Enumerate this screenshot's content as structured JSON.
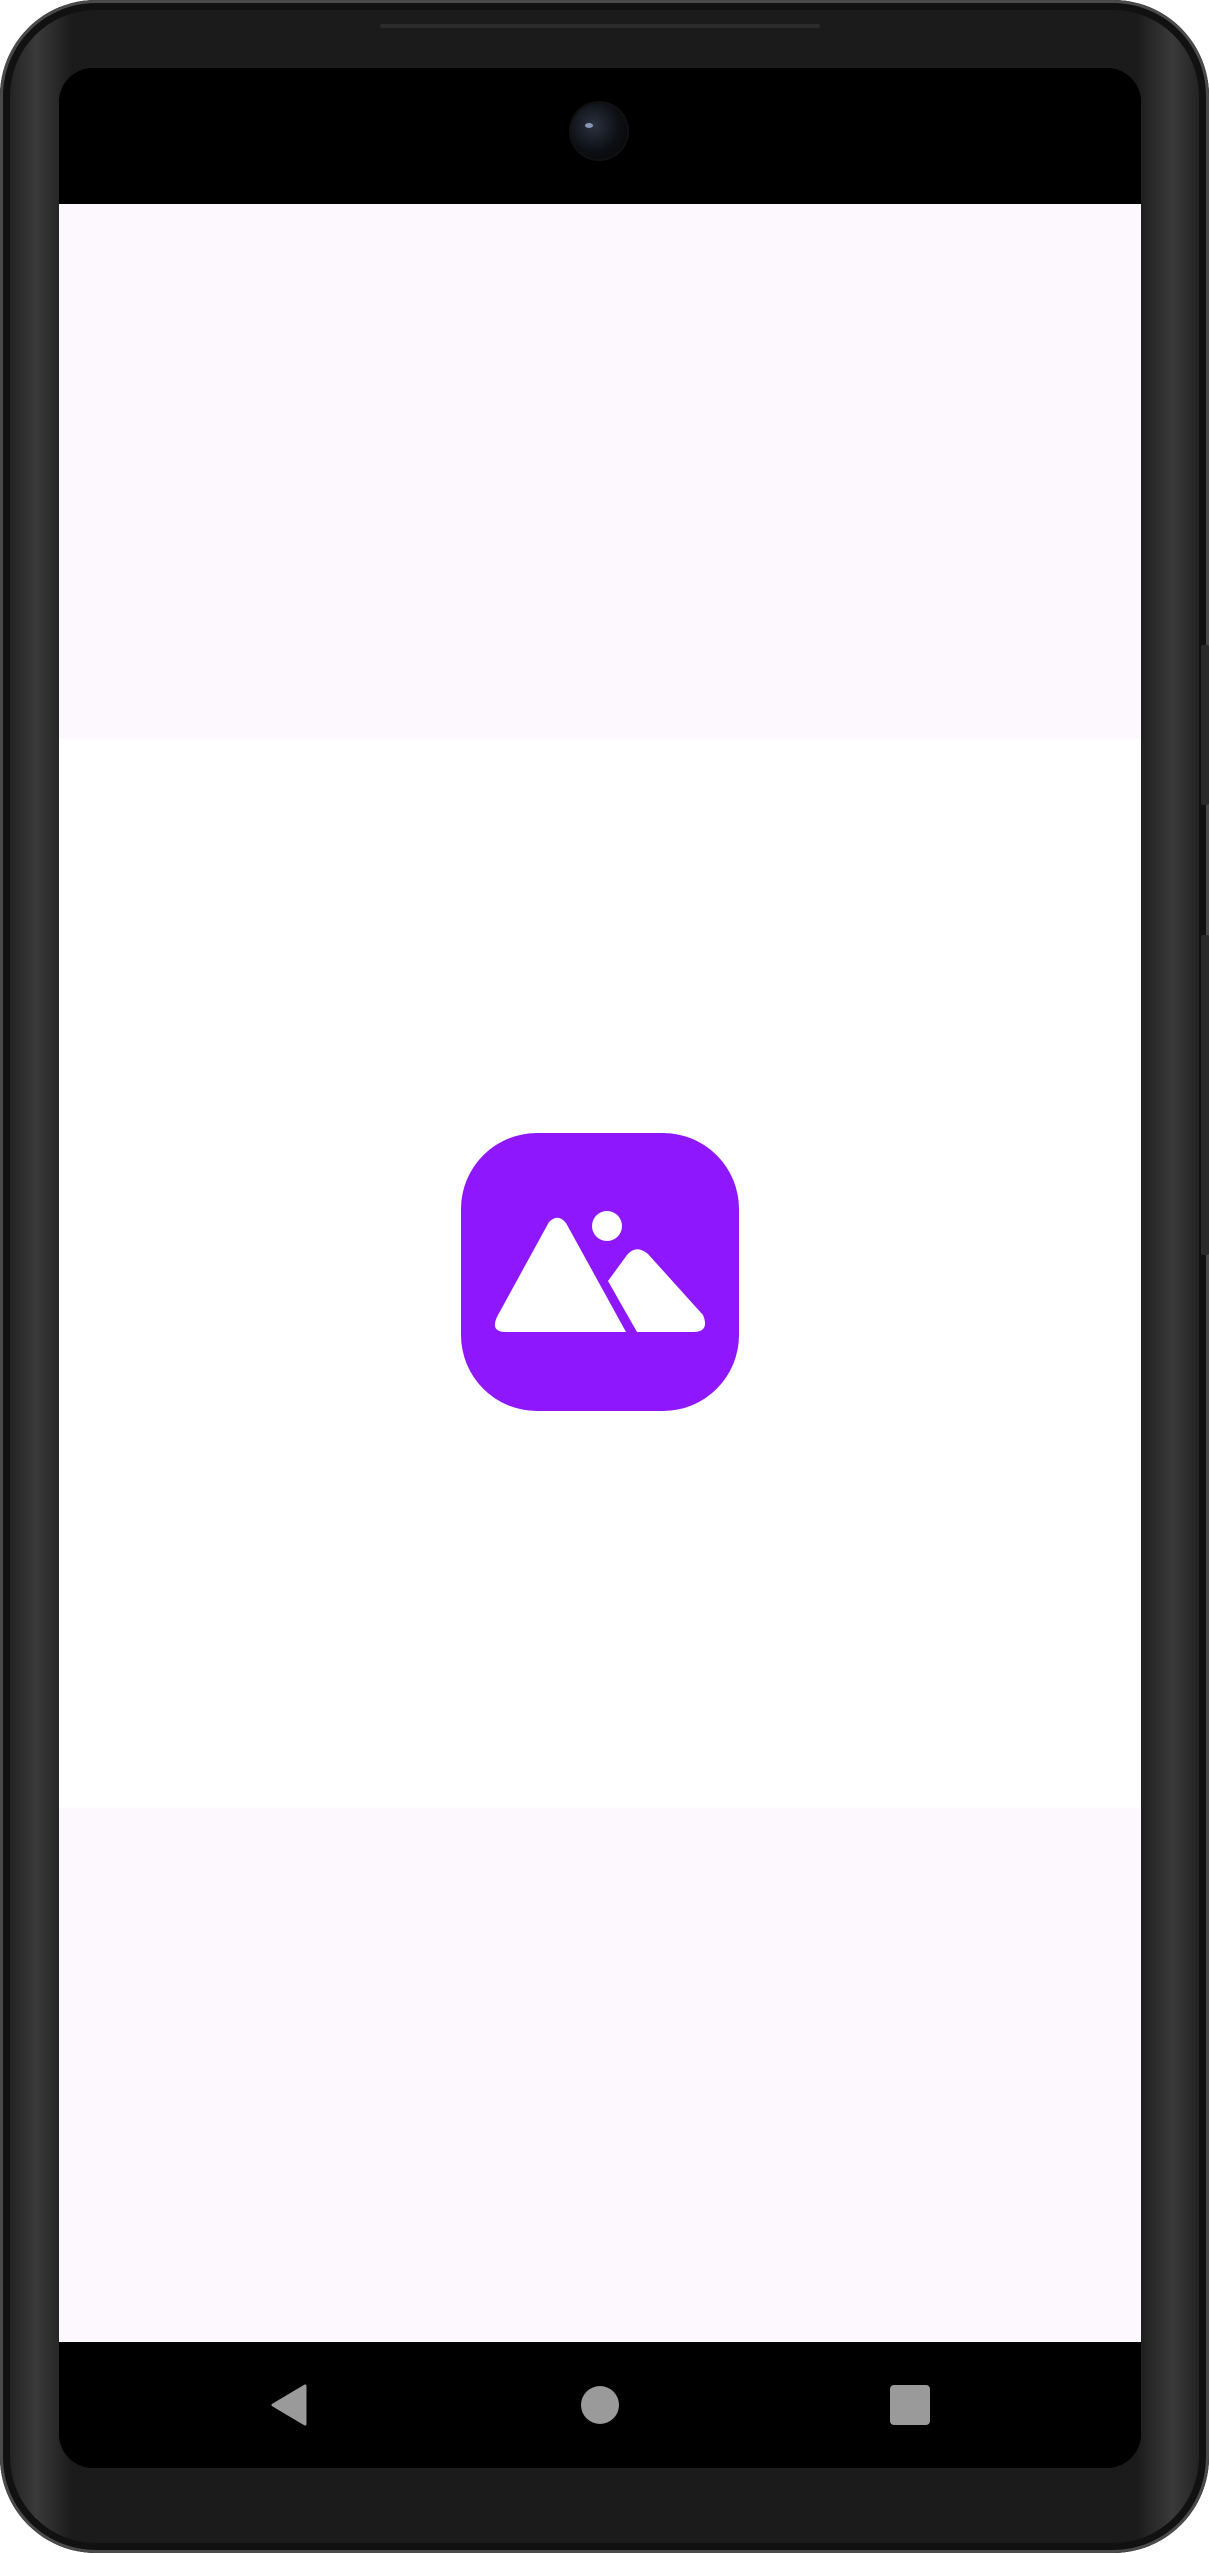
{
  "device": {
    "frame_color": "#1b1b1b",
    "screen_background": "#fdf8fd"
  },
  "splash": {
    "icon": "image-mountains-icon",
    "icon_background": "#8f17fe",
    "icon_foreground": "#ffffff"
  },
  "navigation": {
    "back_icon": "back-triangle-icon",
    "home_icon": "home-circle-icon",
    "recents_icon": "recents-square-icon",
    "icon_color": "#9a9a9a"
  }
}
